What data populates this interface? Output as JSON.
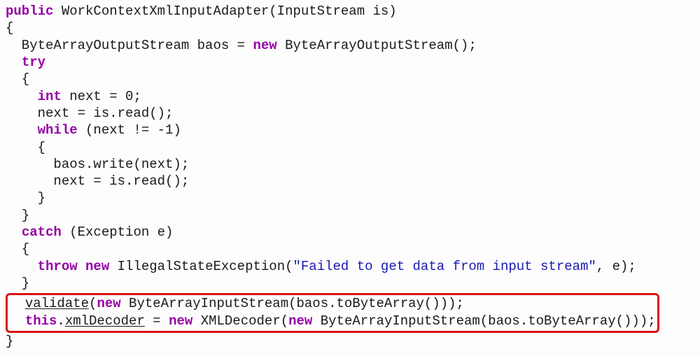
{
  "tokens": {
    "kw_public": "public",
    "kw_new1": "new",
    "kw_try": "try",
    "kw_int": "int",
    "kw_while": "while",
    "kw_catch": "catch",
    "kw_throw": "throw",
    "kw_new2": "new",
    "kw_new3": "new",
    "kw_this": "this",
    "kw_new4": "new",
    "kw_new5": "new"
  },
  "text": {
    "sig_name": " WorkContextXmlInputAdapter(InputStream is)",
    "baos_decl_a": "  ByteArrayOutputStream baos = ",
    "baos_decl_b": " ByteArrayOutputStream();",
    "int_decl": " next = 0;",
    "read1": "    next = is.read();",
    "while_cond": " (next != -1)",
    "write": "      baos.write(next);",
    "read2": "      next = is.read();",
    "catch_cond": " (Exception e)",
    "throw_a": " IllegalStateException(",
    "throw_msg": "\"Failed to get data from input stream\"",
    "throw_b": ", e);",
    "validate_a": "validate",
    "validate_b": "(",
    "validate_c": " ByteArrayInputStream(baos.toByteArray()));",
    "xmldec_a": "xmlDecoder",
    "xmldec_b": " = ",
    "xmldec_c": " XMLDecoder(",
    "xmldec_d": " ByteArrayInputStream(baos.toByteArray()));"
  }
}
